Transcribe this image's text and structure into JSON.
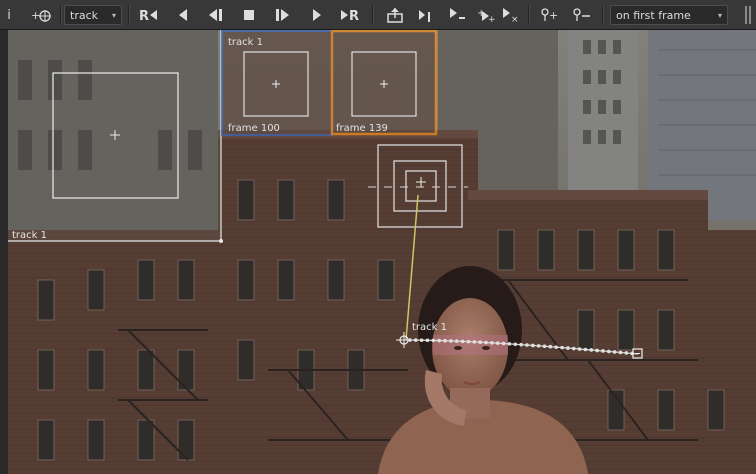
{
  "toolbar": {
    "info_glyph": "i",
    "track_dropdown": "track",
    "track_dropdown_arrow": "▾",
    "reference_dropdown": "on first frame",
    "reference_dropdown_arrow": "▾",
    "buttons": [
      {
        "name": "info-icon",
        "glyph": "i"
      },
      {
        "name": "add-track-icon",
        "glyph": "+⌖"
      },
      {
        "name": "track-range-backward-icon",
        "glyph": "R⏴"
      },
      {
        "name": "track-backward-icon",
        "glyph": "⏴"
      },
      {
        "name": "track-prev-frame-icon",
        "glyph": "⏴|"
      },
      {
        "name": "stop-icon",
        "glyph": "■"
      },
      {
        "name": "track-next-frame-icon",
        "glyph": "|⏵"
      },
      {
        "name": "track-forward-icon",
        "glyph": "⏵"
      },
      {
        "name": "track-range-forward-icon",
        "glyph": "⏵R"
      },
      {
        "name": "key-icon",
        "glyph": "⇪"
      },
      {
        "name": "key-frame-icon",
        "glyph": "⏵|"
      },
      {
        "name": "clear-backward-icon",
        "glyph": "⏵"
      },
      {
        "name": "clear-all-icon",
        "glyph": "⏵"
      },
      {
        "name": "clear-forward-icon",
        "glyph": "⏵"
      },
      {
        "name": "add-keyframe-icon",
        "glyph": "⚲+"
      },
      {
        "name": "remove-keyframe-icon",
        "glyph": "⚲−"
      }
    ]
  },
  "viewer": {
    "zoom_window_label": "track 1",
    "keyframe_panel_title": "track 1",
    "keyframe_1_label": "frame 100",
    "keyframe_2_label": "frame 139",
    "track_label": "track 1",
    "colors": {
      "keyframe_border": "#3c64b4",
      "selected_keyframe": "#f08a1e",
      "track_line": "#c8c864",
      "anchor_path": "#d8d8d8"
    }
  }
}
